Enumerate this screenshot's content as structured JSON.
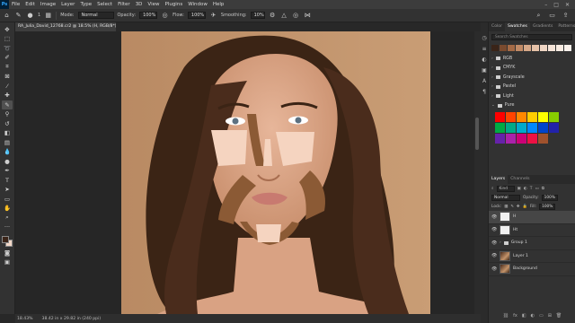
{
  "app": {
    "logo": "Ps",
    "menu": [
      "File",
      "Edit",
      "Image",
      "Layer",
      "Type",
      "Select",
      "Filter",
      "3D",
      "View",
      "Plugins",
      "Window",
      "Help"
    ],
    "window_controls": [
      "–",
      "□",
      "✕"
    ]
  },
  "options": {
    "mode_label": "Mode:",
    "mode_value": "Normal",
    "opacity_label": "Opacity:",
    "opacity_value": "100%",
    "flow_label": "Flow:",
    "flow_value": "100%",
    "smoothing_label": "Smoothing:",
    "smoothing_value": "10%",
    "brush_size": "1"
  },
  "document": {
    "tab_title": "RA_Julia_David_12768.cr2 @ 18.5% (H, RGB/8*) ×"
  },
  "status": {
    "zoom": "18.43%",
    "size": "38.42 in x 29.82 in (240 ppi)"
  },
  "swatches_panel": {
    "tabs": [
      "Color",
      "Swatches",
      "Gradients",
      "Patterns"
    ],
    "active_tab": "Swatches",
    "search_placeholder": "Search Swatches",
    "recent_colors": [
      "#3a2418",
      "#7a4a2e",
      "#a46a46",
      "#c08a66",
      "#d6a888",
      "#e6c2a8",
      "#f0d6c4",
      "#f6e4d8",
      "#f9ece2",
      "#fbf2ec"
    ],
    "folders": [
      "RGB",
      "CMYK",
      "Grayscale",
      "Pastel",
      "Light",
      "Pure"
    ],
    "pure_colors": [
      "#ff0000",
      "#ff4400",
      "#ff8800",
      "#ffcc00",
      "#ffff00",
      "#88cc00",
      "#00aa44",
      "#00aa88",
      "#00aacc",
      "#0088ff",
      "#0044cc",
      "#2222aa",
      "#6622aa",
      "#aa22aa",
      "#cc0077",
      "#ee1144",
      "#a0522d"
    ]
  },
  "layers_panel": {
    "tabs": [
      "Layers",
      "Channels"
    ],
    "active_tab": "Layers",
    "kind_label": "Kind",
    "blend_mode": "Normal",
    "opacity_label": "Opacity:",
    "opacity_value": "100%",
    "lock_label": "Lock:",
    "fill_label": "Fill:",
    "fill_value": "100%",
    "layers": [
      {
        "name": "H",
        "type": "blank",
        "selected": true
      },
      {
        "name": "Ht",
        "type": "blank",
        "selected": false
      },
      {
        "name": "Group 1",
        "type": "group",
        "selected": false
      },
      {
        "name": "Layer 1",
        "type": "photo",
        "selected": false
      },
      {
        "name": "Background",
        "type": "photo",
        "selected": false
      }
    ],
    "footer_icons": [
      "link",
      "fx",
      "mask",
      "adjust",
      "folder",
      "new",
      "trash"
    ]
  },
  "colors": {
    "skin_bg": "#c4946a",
    "contour": "#8b5a35",
    "highlight": "#f5d4c0",
    "hair": "#3b2415"
  }
}
